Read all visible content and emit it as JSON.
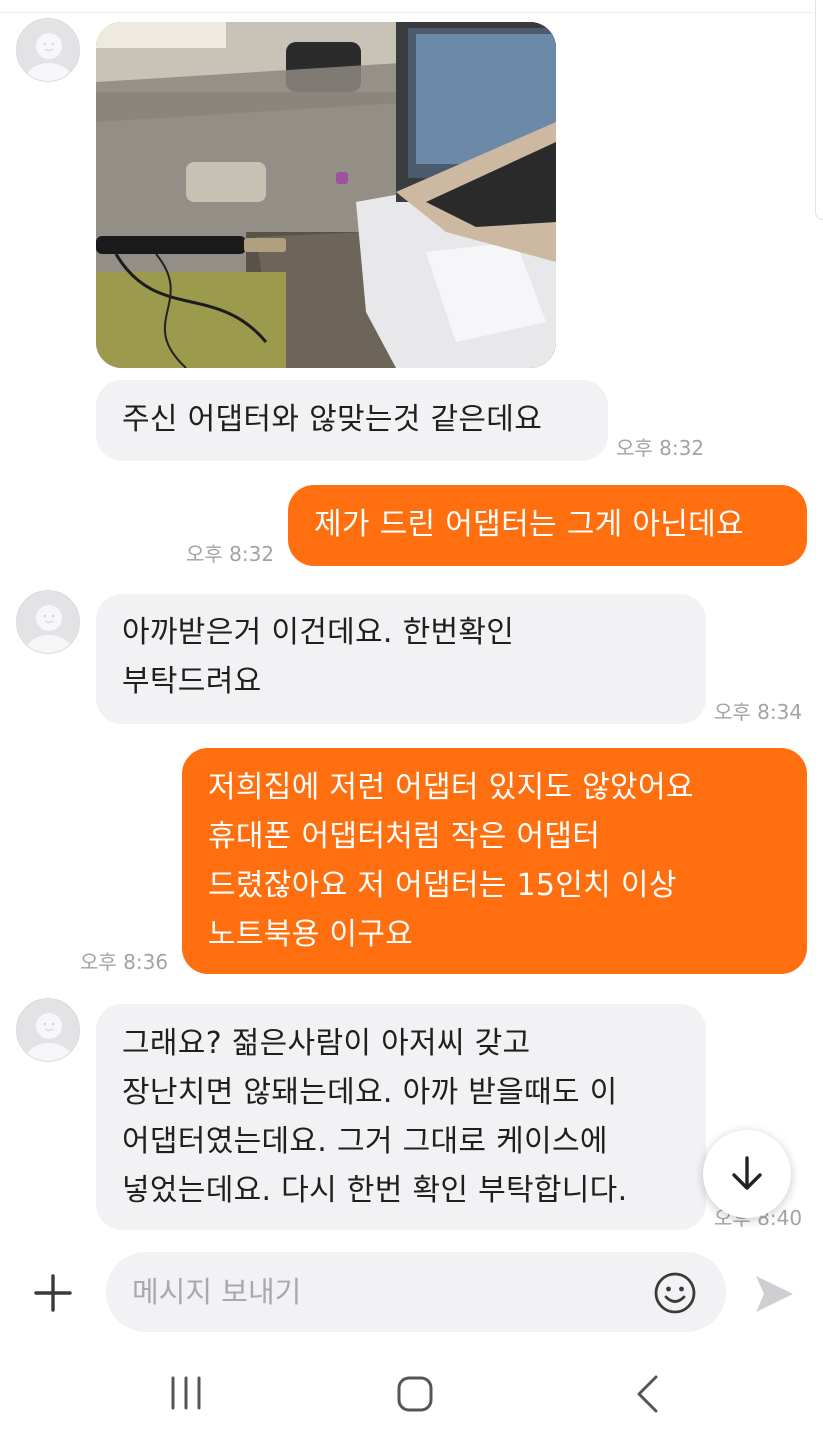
{
  "messages": [
    {
      "type": "image",
      "sender": "other",
      "image_alt": "photo of adapter"
    },
    {
      "type": "text",
      "sender": "other",
      "text": "주신 어댑터와 않맞는것 같은데요",
      "time": "오후 8:32"
    },
    {
      "type": "text",
      "sender": "me",
      "text": "제가 드린 어댑터는 그게 아닌데요",
      "time": "오후 8:32"
    },
    {
      "type": "text",
      "sender": "other",
      "text": "아까받은거 이건데요. 한번확인\n부탁드려요",
      "time": "오후 8:34"
    },
    {
      "type": "text",
      "sender": "me",
      "text": "저희집에 저런 어댑터 있지도 않았어요\n휴대폰 어댑터처럼 작은 어댑터\n드렸잖아요 저 어댑터는 15인치 이상\n노트북용 이구요",
      "time": "오후 8:36"
    },
    {
      "type": "text",
      "sender": "other",
      "text": "그래요? 젊은사람이 아저씨 갖고\n장난치면 않돼는데요. 아까 받을때도 이\n어댑터였는데요. 그거 그대로 케이스에\n넣었는데요. 다시 한번 확인 부탁합니다.",
      "time": "오후 8:40"
    }
  ],
  "input": {
    "placeholder": "메시지 보내기"
  },
  "icons": {
    "avatar": "avatar-default-icon",
    "scroll_down": "arrow-down-icon",
    "attach": "plus-icon",
    "emoji": "emoji-icon",
    "send": "send-icon",
    "nav_recent": "recent-apps-icon",
    "nav_home": "home-icon",
    "nav_back": "back-icon"
  },
  "colors": {
    "outgoing_bubble": "#ff6f0f",
    "incoming_bubble": "#f2f2f5",
    "timestamp": "#a3a3a3"
  }
}
